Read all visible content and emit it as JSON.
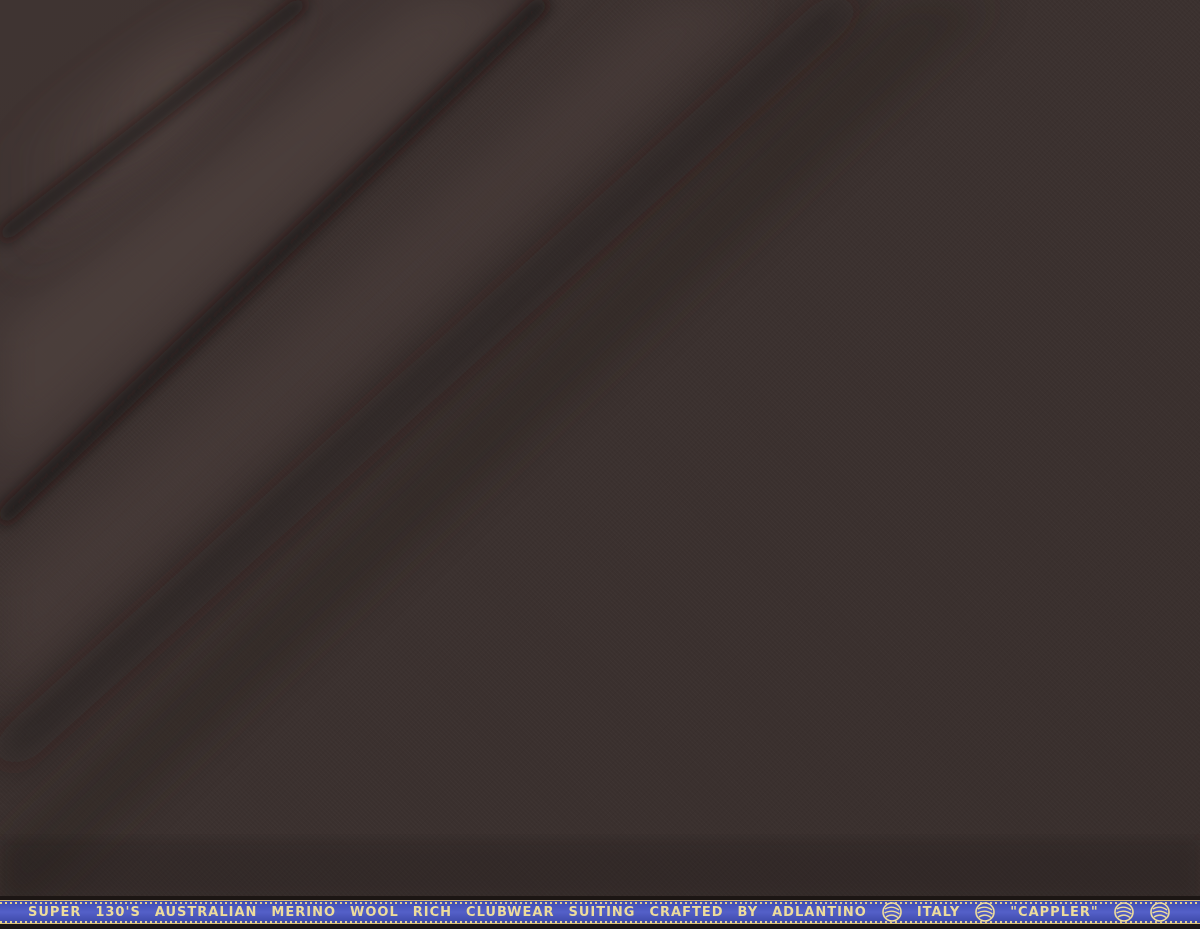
{
  "image": {
    "subject": "folded dark brown suiting fabric with woven selvedge",
    "fabric_color": "#3b312f",
    "selvedge_band_color": "#4a56bd",
    "selvedge_text_color": "#eddc9c"
  },
  "selvedge": {
    "words": [
      "SUPER",
      "130'S",
      "AUSTRALIAN",
      "MERINO",
      "WOOL",
      "RICH",
      "CLUBWEAR",
      "SUITING",
      "CRAFTED",
      "BY",
      "ADLANTINO"
    ],
    "country": "ITALY",
    "name": "\"CAPPLER\"",
    "logo_icon": "yarn-ball-icon"
  }
}
